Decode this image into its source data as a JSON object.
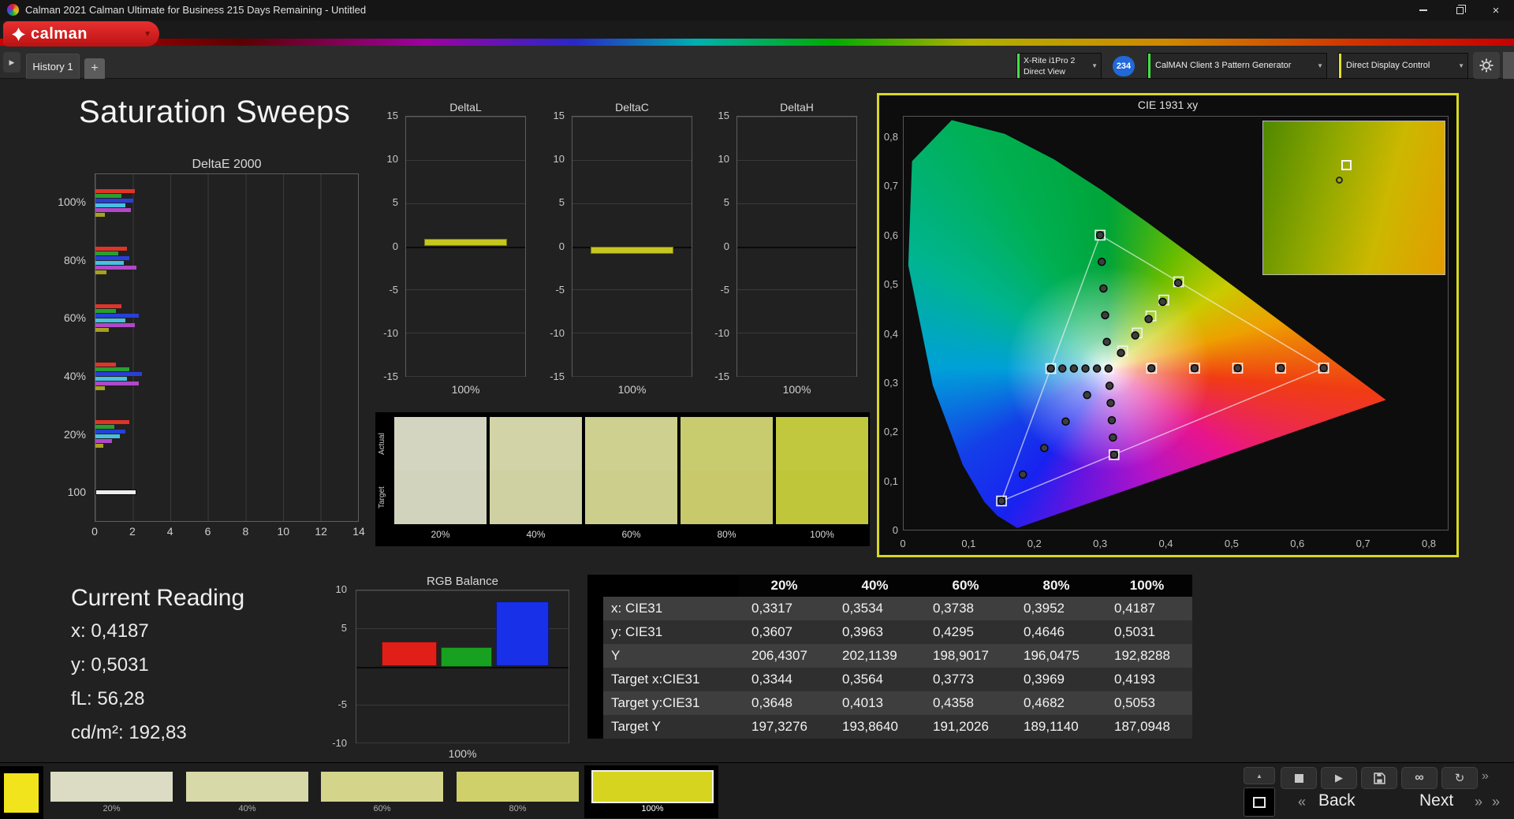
{
  "window": {
    "title": "Calman 2021 Calman Ultimate for Business 215 Days Remaining  - Untitled"
  },
  "brand": {
    "name": "calman",
    "logo_red": "#d42020"
  },
  "tab_bar": {
    "tabs": [
      {
        "label": "History 1"
      }
    ],
    "add_label": "+"
  },
  "toolbar": {
    "meter": {
      "line1": "X-Rite i1Pro 2",
      "line2": "Direct View",
      "badge": "234",
      "accent_color": "#44e044"
    },
    "pattern_generator": "CalMAN Client 3 Pattern Generator",
    "pattern_generator_accent": "#44e044",
    "display_control": "Direct Display Control",
    "display_control_accent": "#e0e030"
  },
  "page_title": "Saturation Sweeps",
  "charts": {
    "delta_e": {
      "type": "bar",
      "title": "DeltaE 2000",
      "x_ticks": [
        "0",
        "2",
        "4",
        "6",
        "8",
        "10",
        "12",
        "14"
      ],
      "x_max": 14,
      "series_colors": [
        "#e03428",
        "#28a030",
        "#2840d8",
        "#48c0e0",
        "#b048c8",
        "#a8a020"
      ],
      "groups": [
        {
          "label": "100%",
          "values": [
            2.1,
            1.4,
            2.0,
            1.6,
            1.9,
            0.5
          ]
        },
        {
          "label": "80%",
          "values": [
            1.7,
            1.2,
            1.8,
            1.5,
            2.2,
            0.6
          ]
        },
        {
          "label": "60%",
          "values": [
            1.4,
            1.1,
            2.3,
            1.6,
            2.1,
            0.7
          ]
        },
        {
          "label": "40%",
          "values": [
            1.1,
            1.8,
            2.5,
            1.7,
            2.3,
            0.5
          ]
        },
        {
          "label": "20%",
          "values": [
            1.8,
            1.0,
            1.6,
            1.3,
            0.9,
            0.4
          ]
        },
        {
          "label": "100",
          "values": [
            2.2
          ],
          "white": true
        }
      ]
    },
    "mini": [
      {
        "title": "DeltaL",
        "value": 0.9,
        "x_label": "100%",
        "ticks": [
          15,
          10,
          5,
          0,
          -5,
          -10,
          -15
        ],
        "y_min": -15,
        "y_max": 15,
        "bar_color": "#c6c620"
      },
      {
        "title": "DeltaC",
        "value": -0.9,
        "x_label": "100%",
        "ticks": [
          15,
          10,
          5,
          0,
          -5,
          -10,
          -15
        ],
        "y_min": -15,
        "y_max": 15,
        "bar_color": "#c6c620"
      },
      {
        "title": "DeltaH",
        "value": 0,
        "x_label": "100%",
        "ticks": [
          15,
          10,
          5,
          0,
          -5,
          -10,
          -15
        ],
        "y_min": -15,
        "y_max": 15,
        "bar_color": "#c6c620"
      }
    ],
    "rgb_balance": {
      "type": "bar",
      "title": "RGB Balance",
      "x_label": "100%",
      "tick_labels": [
        10,
        5,
        -5,
        -10
      ],
      "gridlines": [
        10,
        5,
        0,
        -5,
        -10
      ],
      "y_min": -10,
      "y_max": 10,
      "bars": [
        {
          "name": "red",
          "value": 3.3,
          "color": "#e02018"
        },
        {
          "name": "green",
          "value": 2.5,
          "color": "#18a020"
        },
        {
          "name": "blue",
          "value": 8.6,
          "color": "#1830e8"
        }
      ]
    }
  },
  "swatch_panel": {
    "row_labels": [
      "Actual",
      "Target"
    ],
    "columns": [
      {
        "label": "20%",
        "actual": "#d4d5c0",
        "target": "#d2d3bd"
      },
      {
        "label": "40%",
        "actual": "#d2d3a6",
        "target": "#d0d1a2"
      },
      {
        "label": "60%",
        "actual": "#ced08f",
        "target": "#ccce8b"
      },
      {
        "label": "80%",
        "actual": "#c9cb6f",
        "target": "#c7c96b"
      },
      {
        "label": "100%",
        "actual": "#c2c83d",
        "target": "#c0c639"
      }
    ]
  },
  "cie": {
    "title": "CIE 1931 xy",
    "x_ticks": [
      "0",
      "0,1",
      "0,2",
      "0,3",
      "0,4",
      "0,5",
      "0,6",
      "0,7",
      "0,8"
    ],
    "y_ticks": [
      "0,8",
      "0,7",
      "0,6",
      "0,5",
      "0,4",
      "0,3",
      "0,2",
      "0,1",
      "0"
    ],
    "border_color": "#d8d822",
    "white_point": [
      0.3127,
      0.329
    ],
    "gamut_triangle": [
      [
        0.64,
        0.33
      ],
      [
        0.3,
        0.6
      ],
      [
        0.15,
        0.06
      ]
    ],
    "sweeps": {
      "yellow": {
        "measured": [
          [
            0.3317,
            0.3607
          ],
          [
            0.3534,
            0.3963
          ],
          [
            0.3738,
            0.4295
          ],
          [
            0.3952,
            0.4646
          ],
          [
            0.4187,
            0.5031
          ]
        ],
        "targets": [
          [
            0.3344,
            0.3648
          ],
          [
            0.3564,
            0.4013
          ],
          [
            0.3773,
            0.4358
          ],
          [
            0.3969,
            0.4682
          ],
          [
            0.4193,
            0.5053
          ]
        ]
      },
      "red": {
        "measured": [
          [
            0.378,
            0.3295
          ],
          [
            0.4437,
            0.3297
          ],
          [
            0.5093,
            0.3299
          ],
          [
            0.575,
            0.33
          ],
          [
            0.64,
            0.33
          ]
        ],
        "targets": [
          [
            0.3783,
            0.3295
          ],
          [
            0.4437,
            0.3297
          ],
          [
            0.5092,
            0.3298
          ],
          [
            0.5746,
            0.3299
          ],
          [
            0.64,
            0.33
          ]
        ]
      },
      "green": {
        "measured": [
          [
            0.3102,
            0.3832
          ],
          [
            0.3076,
            0.4374
          ],
          [
            0.3051,
            0.4916
          ],
          [
            0.3025,
            0.5458
          ],
          [
            0.3,
            0.6
          ]
        ],
        "targets": [
          [
            0.3,
            0.6
          ]
        ]
      },
      "blue": {
        "measured": [
          [
            0.2802,
            0.2752
          ],
          [
            0.2476,
            0.2214
          ],
          [
            0.2151,
            0.1676
          ],
          [
            0.1825,
            0.1138
          ],
          [
            0.15,
            0.06
          ]
        ],
        "targets": [
          [
            0.15,
            0.06
          ]
        ]
      },
      "cyan": {
        "measured": [
          [
            0.2952,
            0.329
          ],
          [
            0.2777,
            0.329
          ],
          [
            0.2601,
            0.329
          ],
          [
            0.2426,
            0.329
          ],
          [
            0.225,
            0.329
          ]
        ],
        "targets": [
          [
            0.225,
            0.329
          ]
        ]
      },
      "magenta": {
        "measured": [
          [
            0.3144,
            0.294
          ],
          [
            0.3161,
            0.259
          ],
          [
            0.3178,
            0.224
          ],
          [
            0.3195,
            0.189
          ],
          [
            0.3212,
            0.154
          ]
        ],
        "targets": [
          [
            0.3212,
            0.154
          ]
        ]
      }
    }
  },
  "current_reading": {
    "title": "Current Reading",
    "lines": [
      "x: 0,4187",
      "y: 0,5031",
      "fL: 56,28",
      "cd/m²: 192,83"
    ]
  },
  "table": {
    "columns": [
      "20%",
      "40%",
      "60%",
      "80%",
      "100%"
    ],
    "rows": [
      {
        "label": "x: CIE31",
        "values": [
          "0,3317",
          "0,3534",
          "0,3738",
          "0,3952",
          "0,4187"
        ]
      },
      {
        "label": "y: CIE31",
        "values": [
          "0,3607",
          "0,3963",
          "0,4295",
          "0,4646",
          "0,5031"
        ]
      },
      {
        "label": "Y",
        "values": [
          "206,4307",
          "202,1139",
          "198,9017",
          "196,0475",
          "192,8288"
        ]
      },
      {
        "label": "Target x:CIE31",
        "values": [
          "0,3344",
          "0,3564",
          "0,3773",
          "0,3969",
          "0,4193"
        ]
      },
      {
        "label": "Target y:CIE31",
        "values": [
          "0,3648",
          "0,4013",
          "0,4358",
          "0,4682",
          "0,5053"
        ]
      },
      {
        "label": "Target Y",
        "values": [
          "197,3276",
          "193,8640",
          "191,2026",
          "189,1140",
          "187,0948"
        ]
      }
    ]
  },
  "bottom_bar": {
    "current_color": "#f2e41c",
    "swatches": [
      {
        "label": "20%",
        "color": "#dbdcc3"
      },
      {
        "label": "40%",
        "color": "#d8d9a8"
      },
      {
        "label": "60%",
        "color": "#d4d58b"
      },
      {
        "label": "80%",
        "color": "#cfd06a"
      },
      {
        "label": "100%",
        "color": "#d6d41f",
        "active": true
      }
    ],
    "transport_icons": [
      "stop",
      "play",
      "save",
      "link",
      "refresh"
    ],
    "back_label": "Back",
    "next_label": "Next"
  }
}
